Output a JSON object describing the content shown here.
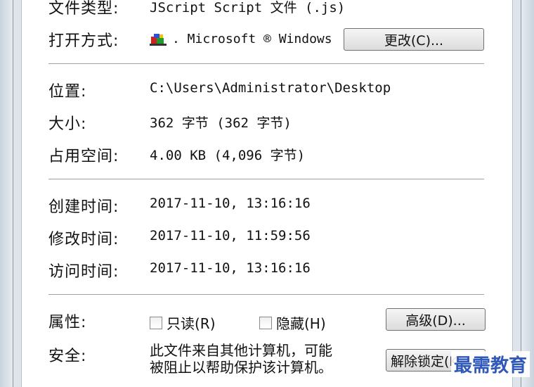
{
  "file_type": {
    "label": "文件类型:",
    "value": "JScript Script 文件 (.js)"
  },
  "open_with": {
    "label": "打开方式:",
    "app": ". Microsoft ® Windows",
    "change_button": "更改(C)..."
  },
  "location": {
    "label": "位置:",
    "value": "C:\\Users\\Administrator\\Desktop"
  },
  "size": {
    "label": "大小:",
    "value": "362 字节 (362 字节)"
  },
  "size_on_disk": {
    "label": "占用空间:",
    "value": "4.00 KB (4,096 字节)"
  },
  "created": {
    "label": "创建时间:",
    "value": "2017-11-10, 13:16:16"
  },
  "modified": {
    "label": "修改时间:",
    "value": "2017-11-10, 11:59:56"
  },
  "accessed": {
    "label": "访问时间:",
    "value": "2017-11-10, 13:16:16"
  },
  "attributes": {
    "label": "属性:",
    "readonly": "只读(R)",
    "hidden": "隐藏(H)",
    "advanced_button": "高级(D)..."
  },
  "security": {
    "label": "安全:",
    "line1": "此文件来自其他计算机，可能",
    "line2": "被阻止以帮助保护该计算机。",
    "unblock_button": "解除锁定(K)"
  },
  "watermark": "最需教育",
  "colors": {
    "watermark": "#2f58b8",
    "separator": "#a0a0a0"
  }
}
